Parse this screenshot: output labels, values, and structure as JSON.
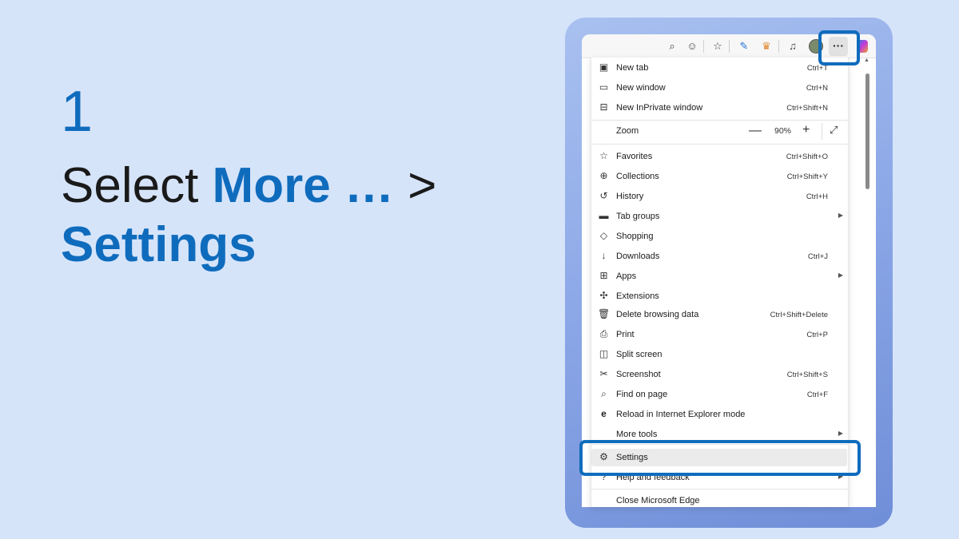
{
  "step": "1",
  "instruction": {
    "prefix": "Select ",
    "more": "More …",
    "separator": " > ",
    "settings": "Settings"
  },
  "toolbar": {
    "icons": [
      "zoom-icon",
      "emoji-icon",
      "favorite-star-icon",
      "extension-pen-icon",
      "rewards-icon",
      "music-icon"
    ],
    "more_label": "···"
  },
  "menu": {
    "items": [
      {
        "label": "New tab",
        "shortcut": "Ctrl+T",
        "icon": "new-tab-icon"
      },
      {
        "label": "New window",
        "shortcut": "Ctrl+N",
        "icon": "new-window-icon"
      },
      {
        "label": "New InPrivate window",
        "shortcut": "Ctrl+Shift+N",
        "icon": "inprivate-icon"
      },
      {
        "label": "Zoom",
        "value": "90%",
        "minus": "—",
        "plus": "+"
      },
      {
        "label": "Favorites",
        "shortcut": "Ctrl+Shift+O",
        "icon": "favorites-icon"
      },
      {
        "label": "Collections",
        "shortcut": "Ctrl+Shift+Y",
        "icon": "collections-icon"
      },
      {
        "label": "History",
        "shortcut": "Ctrl+H",
        "icon": "history-icon"
      },
      {
        "label": "Tab groups",
        "shortcut": "",
        "icon": "tab-groups-icon"
      },
      {
        "label": "Shopping",
        "shortcut": "",
        "icon": "shopping-tag-icon"
      },
      {
        "label": "Downloads",
        "shortcut": "Ctrl+J",
        "icon": "download-icon"
      },
      {
        "label": "Apps",
        "shortcut": "",
        "icon": "apps-icon"
      },
      {
        "label": "Extensions",
        "shortcut": "",
        "icon": "extensions-icon"
      },
      {
        "label": "Delete browsing data",
        "shortcut": "Ctrl+Shift+Delete",
        "icon": "trash-icon"
      },
      {
        "label": "Print",
        "shortcut": "Ctrl+P",
        "icon": "print-icon"
      },
      {
        "label": "Split screen",
        "shortcut": "",
        "icon": "split-screen-icon"
      },
      {
        "label": "Screenshot",
        "shortcut": "Ctrl+Shift+S",
        "icon": "screenshot-icon"
      },
      {
        "label": "Find on page",
        "shortcut": "Ctrl+F",
        "icon": "find-icon"
      },
      {
        "label": "Reload in Internet Explorer mode",
        "shortcut": "",
        "icon": "ie-icon"
      },
      {
        "label": "More tools",
        "shortcut": ""
      },
      {
        "label": "Settings",
        "shortcut": "",
        "icon": "gear-icon"
      },
      {
        "label": "Help and feedback",
        "shortcut": "",
        "icon": "help-icon"
      },
      {
        "label": "Close Microsoft Edge",
        "shortcut": ""
      }
    ]
  },
  "colors": {
    "accent": "#0f6cbd",
    "background": "#d6e4fa",
    "frame": "#8aa6e6"
  }
}
